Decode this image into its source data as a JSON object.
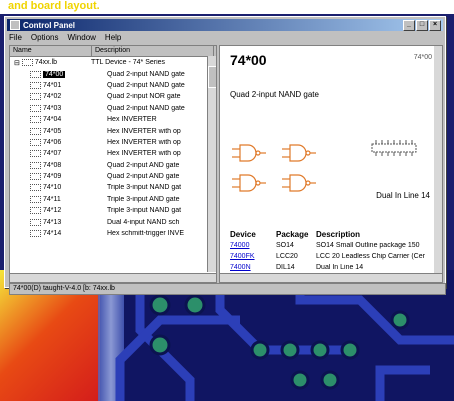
{
  "background": {
    "headline": "and board layout."
  },
  "window": {
    "title": "Control Panel",
    "menu": [
      "File",
      "Options",
      "Window",
      "Help"
    ]
  },
  "tree": {
    "columns": [
      "Name",
      "Description"
    ],
    "root": {
      "name": "74xx.lb",
      "desc": "TTL Device - 74* Series"
    },
    "rows": [
      {
        "name": "74*00",
        "desc": "Quad 2-input NAND gate",
        "selected": true
      },
      {
        "name": "74*01",
        "desc": "Quad 2-input NAND gate"
      },
      {
        "name": "74*02",
        "desc": "Quad 2-input NOR gate"
      },
      {
        "name": "74*03",
        "desc": "Quad 2-input NAND gate"
      },
      {
        "name": "74*04",
        "desc": "Hex INVERTER"
      },
      {
        "name": "74*05",
        "desc": "Hex INVERTER with op"
      },
      {
        "name": "74*06",
        "desc": "Hex INVERTER with op"
      },
      {
        "name": "74*07",
        "desc": "Hex INVERTER with op"
      },
      {
        "name": "74*08",
        "desc": "Quad 2-input AND gate"
      },
      {
        "name": "74*09",
        "desc": "Quad 2-input AND gate"
      },
      {
        "name": "74*10",
        "desc": "Triple 3-input NAND gat"
      },
      {
        "name": "74*11",
        "desc": "Triple 3-input AND gate"
      },
      {
        "name": "74*12",
        "desc": "Triple 3-input NAND gat"
      },
      {
        "name": "74*13",
        "desc": "Dual 4-input NAND sch"
      },
      {
        "name": "74*14",
        "desc": "Hex schmitt-trigger INVE"
      }
    ]
  },
  "detail": {
    "part": "74*00",
    "corner": "74*00",
    "description": "Quad 2-input NAND gate",
    "package_label": "Dual In Line 14",
    "table_headers": [
      "Device",
      "Package",
      "Description"
    ],
    "table_rows": [
      {
        "device": "74000",
        "package": "SO14",
        "description": "SO14 Small Outline package 150"
      },
      {
        "device": "7400FK",
        "package": "LCC20",
        "description": "LCC 20 Leadless Chip Carrier (Cer"
      },
      {
        "device": "7400N",
        "package": "DIL14",
        "description": "Dual In Line 14"
      }
    ]
  },
  "status": {
    "text": "74*00(D) taught-V-4.0 [b: 74xx.lb"
  },
  "colors": {
    "titlebar": "#0a246a",
    "pcb": "#101562",
    "link": "#0000cc"
  }
}
